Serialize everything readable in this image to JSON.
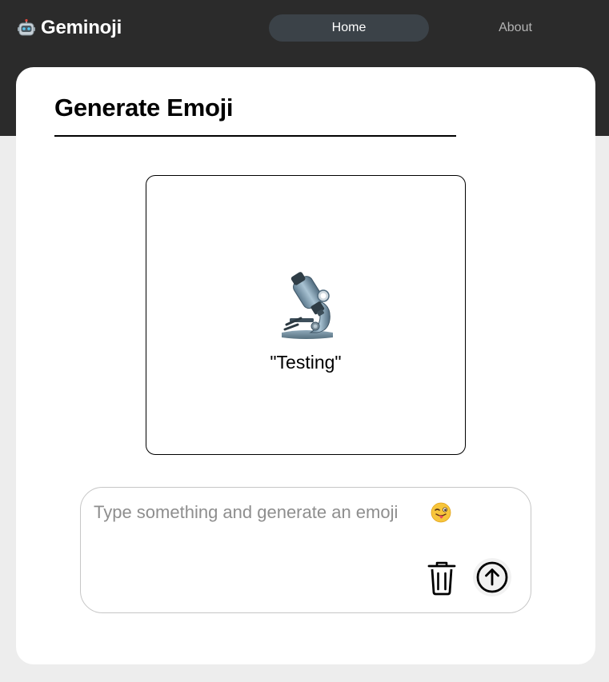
{
  "header": {
    "brand_name": "Geminoji",
    "brand_icon": "robot-icon",
    "nav": {
      "home_label": "Home",
      "about_label": "About"
    }
  },
  "main": {
    "title": "Generate Emoji",
    "result": {
      "emoji": "microscope",
      "caption": "\"Testing\""
    },
    "prompt": {
      "placeholder": "Type something and generate an emoji",
      "placeholder_emoji": "winking-face-with-tongue",
      "value": ""
    },
    "actions": {
      "clear_icon": "trash-icon",
      "submit_icon": "arrow-up-circle-icon"
    }
  },
  "colors": {
    "header_bg": "#2b2b2b",
    "nav_active_bg": "#3b4248",
    "page_bg": "#ededed",
    "card_bg": "#ffffff"
  }
}
